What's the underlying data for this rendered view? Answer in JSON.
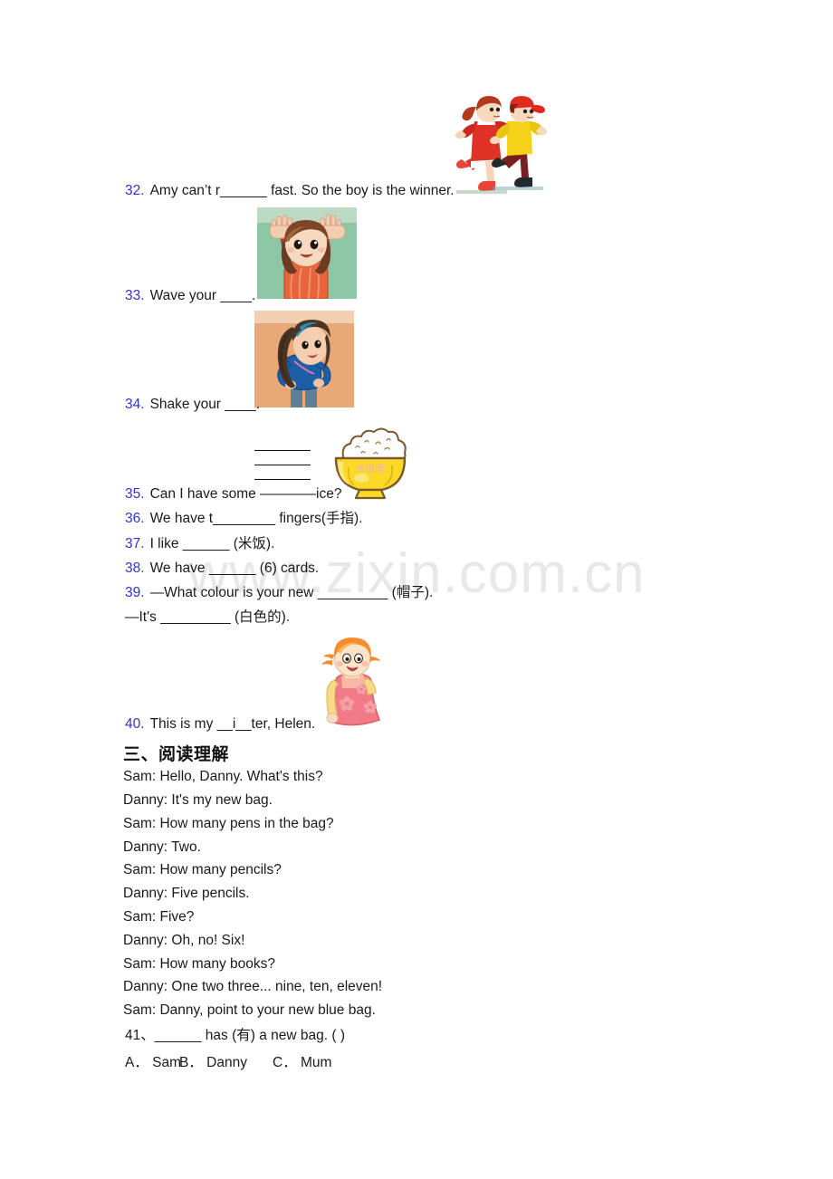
{
  "watermark": "www.zixin.com.cn",
  "fill_in_items": [
    {
      "num": "32.",
      "text": "Amy can’t r______ fast. So the boy is the winner."
    },
    {
      "num": "33.",
      "text": "Wave your ____."
    },
    {
      "num": "34.",
      "text": "Shake your ____."
    },
    {
      "num": "35.",
      "text": "Can I have some ————ice?"
    },
    {
      "num": "36.",
      "text": "We have t________ fingers(手指)."
    },
    {
      "num": "37.",
      "text": "I like ______ (米饭)."
    },
    {
      "num": "38.",
      "text": "We have ______ (6) cards."
    },
    {
      "num": "39.",
      "text": "—What colour is your new _________ (帽子)."
    },
    {
      "num": "",
      "text": "—It's _________ (白色的)."
    },
    {
      "num": "40.",
      "text": "This is my __i__ter, Helen."
    }
  ],
  "section": {
    "heading": "三、阅读理解",
    "dialogue": [
      "Sam: Hello, Danny. What's this?",
      "Danny: It's my new bag.",
      "Sam: How many pens in the bag?",
      "Danny: Two.",
      "Sam: How many pencils?",
      "Danny: Five pencils.",
      "Sam: Five?",
      "Danny: Oh, no! Six!",
      "Sam: How many books?",
      "Danny: One two three... nine, ten, eleven!",
      "Sam: Danny, point to your new blue bag."
    ],
    "question": {
      "num": "41、",
      "text": "______ has (有) a new bag. (   )",
      "choices": [
        "A． Sam",
        "B． Danny",
        "C． Mum"
      ]
    }
  },
  "images": {
    "runners": "two-running-children-illustration",
    "wave": "girl-waving-both-hands-photo",
    "shake": "girl-shaking-body-photo",
    "bowl": "bowl-of-rice-illustration",
    "girl": "girl-in-pink-dress-illustration"
  },
  "colors": {
    "question_number": "#3333cc",
    "text": "#1a1a1a",
    "watermark": "#e8e8e8"
  }
}
